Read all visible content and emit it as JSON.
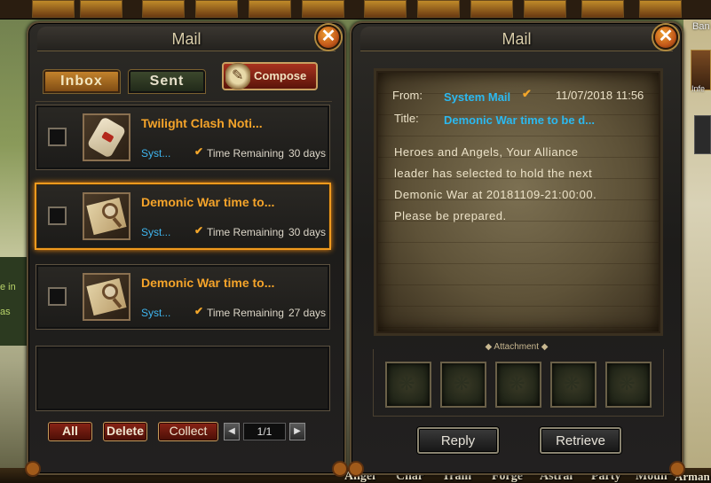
{
  "background": {
    "left_texts": [
      "e in",
      "as"
    ],
    "right_labels": [
      "Ban",
      "Infe"
    ],
    "bottom_nav": [
      "Angel",
      "Char",
      "Train",
      "Forge",
      "Astral",
      "Party",
      "Moun",
      "Arman"
    ]
  },
  "left_panel": {
    "title": "Mail",
    "close_symbol": "✕",
    "tabs": [
      {
        "label": "Inbox",
        "active": true
      },
      {
        "label": "Sent",
        "active": false
      }
    ],
    "compose_label": "Compose",
    "mails": [
      {
        "subject": "Twilight Clash Noti...",
        "sender": "Syst...",
        "time_label": "Time Remaining",
        "time_days": "30 days",
        "icon": "scroll-icon",
        "selected": false
      },
      {
        "subject": "Demonic War time to...",
        "sender": "Syst...",
        "time_label": "Time Remaining",
        "time_days": "30 days",
        "icon": "letter-magnifier-icon",
        "selected": true
      },
      {
        "subject": "Demonic War time to...",
        "sender": "Syst...",
        "time_label": "Time Remaining",
        "time_days": "27 days",
        "icon": "letter-magnifier-icon",
        "selected": false
      }
    ],
    "check_symbol": "✔",
    "buttons": {
      "all": "All",
      "delete": "Delete",
      "collect": "Collect"
    },
    "pager": {
      "value": "1/1",
      "prev": "◀",
      "next": "▶"
    }
  },
  "right_panel": {
    "title": "Mail",
    "close_symbol": "✕",
    "from_label": "From:",
    "from_value": "System Mail",
    "date": "11/07/2018 11:56",
    "title_label": "Title:",
    "title_value": "Demonic War time to be d...",
    "body_lines": [
      "Heroes and Angels, Your Alliance",
      "leader has selected to hold the next",
      "Demonic War at 20181109-21:00:00.",
      "Please be prepared."
    ],
    "attachment_label": "Attachment",
    "attachment_slots": 5,
    "buttons": {
      "reply": "Reply",
      "retrieve": "Retrieve"
    }
  },
  "colors": {
    "accent_orange": "#f5a42a",
    "sender_blue": "#3fb6f0",
    "selection_border": "#f09a1e"
  }
}
